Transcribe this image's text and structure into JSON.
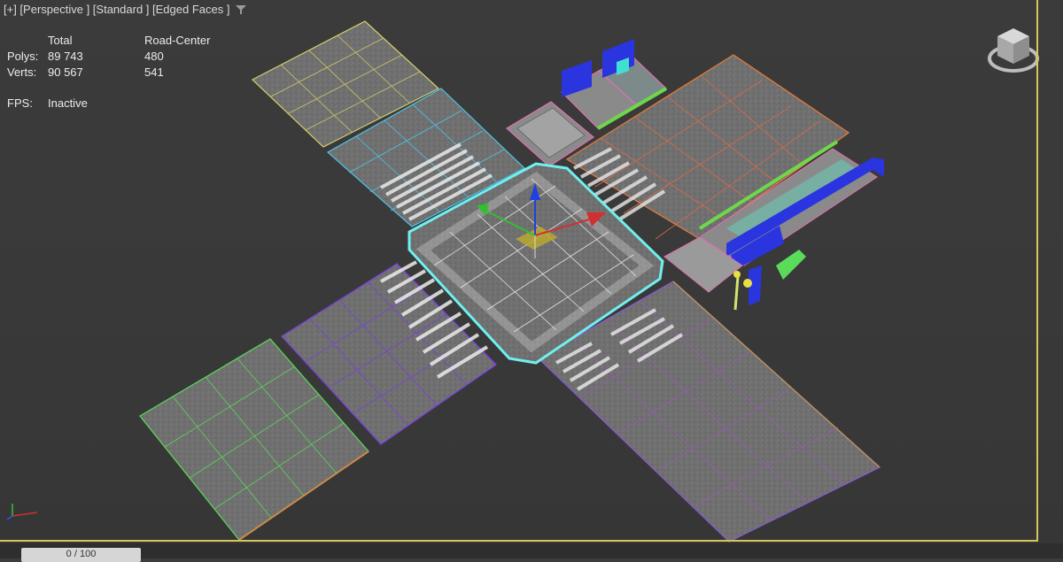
{
  "viewport": {
    "menu_label": "[+] [Perspective ] [Standard ] [Edged Faces ]",
    "filter_icon": "filter-icon"
  },
  "stats": {
    "col_total": "Total",
    "col_selection": "Road-Center",
    "polys_label": "Polys:",
    "polys_total": "89 743",
    "polys_selection": "480",
    "verts_label": "Verts:",
    "verts_total": "90 567",
    "verts_selection": "541",
    "fps_label": "FPS:",
    "fps_value": "Inactive"
  },
  "timeline": {
    "slider_label": "0 / 100"
  },
  "colors": {
    "frame": "#d8c65a",
    "selection": "#6ff0f0",
    "gizmo_x": "#d03030",
    "gizmo_y": "#30c030",
    "gizmo_z": "#2040e0"
  }
}
